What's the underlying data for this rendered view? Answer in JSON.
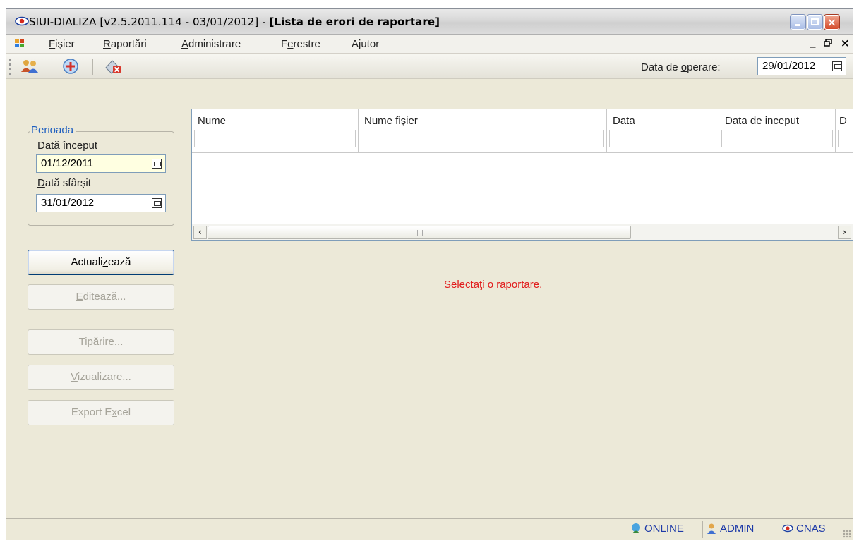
{
  "window": {
    "title_regular": "SIUI-DIALIZA [v2.5.2011.114 - 03/01/2012] - ",
    "title_bold": "[Lista de erori de raportare]",
    "icon": "eye-logo-icon",
    "controls": [
      "minimize-icon",
      "maximize-icon",
      "close-icon"
    ]
  },
  "menu": {
    "items": [
      {
        "pre": "",
        "ul": "F",
        "post": "işier"
      },
      {
        "pre": "",
        "ul": "R",
        "post": "aportări"
      },
      {
        "pre": "",
        "ul": "A",
        "post": "dministrare"
      },
      {
        "pre": "F",
        "ul": "e",
        "post": "restre"
      },
      {
        "pre": "A",
        "ul": "j",
        "post": "utor"
      }
    ],
    "mdi_min": "_",
    "mdi_restore": " ",
    "mdi_close": "×"
  },
  "toolbar": {
    "icons": [
      "patients-icon",
      "dialysis-session-icon",
      "delete-report-icon"
    ],
    "operating_date_label_pre": "Data de ",
    "operating_date_label_ul": "o",
    "operating_date_label_post": "perare:",
    "operating_date": "29/01/2012"
  },
  "period": {
    "title": "Perioada",
    "start_label_ul": "D",
    "start_label_post": "ată început",
    "start_value": "01/12/2011",
    "end_label_ul": "D",
    "end_label_post": "ată sfârşit",
    "end_value": "31/01/2012"
  },
  "buttons": {
    "refresh_pre": "Actuali",
    "refresh_ul": "z",
    "refresh_post": "ează",
    "edit_ul": "E",
    "edit_post": "ditează...",
    "print_ul": "T",
    "print_post": "ipărire...",
    "view_ul": "V",
    "view_post": "izualizare...",
    "export_pre": "Export E",
    "export_ul": "x",
    "export_post": "cel"
  },
  "grid": {
    "columns": [
      "Nume",
      "Nume fişier",
      "Data",
      "Data de inceput",
      "D"
    ]
  },
  "message": "Selectaţi o raportare.",
  "status": {
    "online": "ONLINE",
    "user": "ADMIN",
    "org": "CNAS"
  },
  "colors": {
    "message": "#e11b1b",
    "group_title": "#1f5fbf",
    "status_text": "#1e3aa8",
    "start_date_bg": "#ffffe1"
  }
}
